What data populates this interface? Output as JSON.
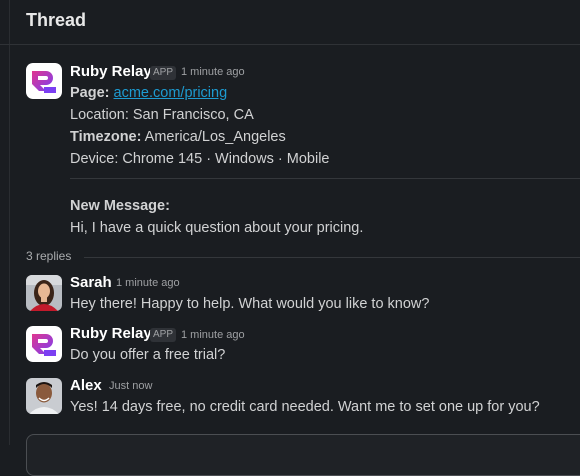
{
  "header": {
    "title": "Thread"
  },
  "parent": {
    "author": "Ruby Relay",
    "badge": "APP",
    "time": "1 minute ago",
    "page_label": "Page:",
    "page_link": "acme.com/pricing",
    "location": "Location: San Francisco, CA",
    "timezone_label": "Timezone:",
    "timezone_value": " America/Los_Angeles",
    "device": "Device: Chrome 145 · Windows · Mobile",
    "new_message_label": "New Message:",
    "new_message_text": "Hi, I have a quick question about your pricing."
  },
  "replies_count": "3 replies",
  "replies": [
    {
      "author": "Sarah",
      "time": "1 minute ago",
      "text": "Hey there! Happy to help. What would you like to know?"
    },
    {
      "author": "Ruby Relay",
      "badge": "APP",
      "time": "1 minute ago",
      "text": "Do you offer a free trial?"
    },
    {
      "author": "Alex",
      "time": "Just now",
      "text": "Yes! 14 days free, no credit card needed. Want me to set one up for you?"
    }
  ],
  "colors": {
    "background": "#1a1d21",
    "link": "#1d9bd1",
    "brand_gradient_start": "#e0368f",
    "brand_gradient_end": "#7b3ff2"
  },
  "icons": {
    "app_logo": "ruby-relay-logo-icon",
    "user_avatar": "person-avatar"
  }
}
